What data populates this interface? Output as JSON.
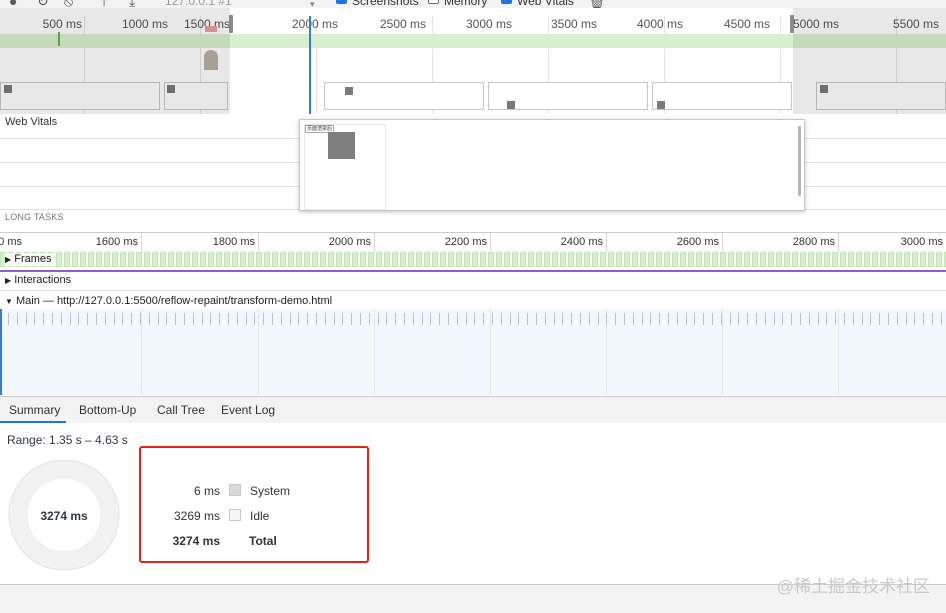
{
  "toolbar": {
    "url": "127.0.0.1 #1",
    "screenshots_label": "Screenshots",
    "memory_label": "Memory",
    "webvitals_label": "Web Vitals",
    "screenshots_checked": true,
    "memory_checked": false,
    "webvitals_checked": true
  },
  "overview": {
    "ticks": [
      "500 ms",
      "1000 ms",
      "1500 ms",
      "2000 ms",
      "2500 ms",
      "3000 ms",
      "3500 ms",
      "4000 ms",
      "4500 ms",
      "5000 ms",
      "5500 ms"
    ]
  },
  "tooltip": {
    "thumb_caption": "页面渲染后"
  },
  "tracks": {
    "web_vitals": "Web Vitals",
    "long_tasks": "LONG TASKS",
    "frames": "Frames",
    "interactions": "Interactions",
    "main": "Main — http://127.0.0.1:5500/reflow-repaint/transform-demo.html"
  },
  "ruler": {
    "ticks": [
      "0 ms",
      "1600 ms",
      "1800 ms",
      "2000 ms",
      "2200 ms",
      "2400 ms",
      "2600 ms",
      "2800 ms",
      "3000 ms"
    ]
  },
  "tabs": [
    "Summary",
    "Bottom-Up",
    "Call Tree",
    "Event Log"
  ],
  "summary": {
    "range": "Range: 1.35 s – 4.63 s",
    "total_center": "3274 ms",
    "rows": [
      {
        "value": "6 ms",
        "label": "System",
        "color": "#dadada"
      },
      {
        "value": "3269 ms",
        "label": "Idle",
        "color": "#f5f5f5"
      },
      {
        "value": "3274 ms",
        "label": "Total"
      }
    ]
  },
  "watermark": "@稀土掘金技术社区"
}
